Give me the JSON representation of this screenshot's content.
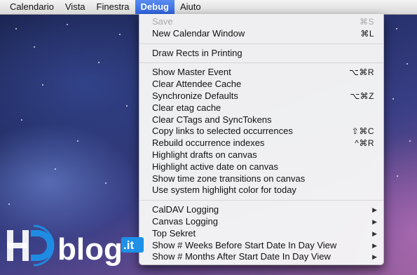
{
  "menubar": {
    "items": [
      {
        "label": "Calendario"
      },
      {
        "label": "Vista"
      },
      {
        "label": "Finestra"
      },
      {
        "label": "Debug"
      },
      {
        "label": "Aiuto"
      }
    ]
  },
  "debug_menu": {
    "groups": [
      [
        {
          "label": "Save",
          "shortcut": "⌘S",
          "enabled": false
        },
        {
          "label": "New Calendar Window",
          "shortcut": "⌘L",
          "enabled": true
        }
      ],
      [
        {
          "label": "Draw Rects in Printing",
          "shortcut": "",
          "enabled": true
        }
      ],
      [
        {
          "label": "Show Master Event",
          "shortcut": "⌥⌘R",
          "enabled": true
        },
        {
          "label": "Clear Attendee Cache",
          "shortcut": "",
          "enabled": true
        },
        {
          "label": "Synchronize Defaults",
          "shortcut": "⌥⌘Z",
          "enabled": true
        },
        {
          "label": "Clear etag cache",
          "shortcut": "",
          "enabled": true
        },
        {
          "label": "Clear CTags and SyncTokens",
          "shortcut": "",
          "enabled": true
        },
        {
          "label": "Copy links to selected occurrences",
          "shortcut": "⇧⌘C",
          "enabled": true
        },
        {
          "label": "Rebuild occurrence indexes",
          "shortcut": "^⌘R",
          "enabled": true
        },
        {
          "label": "Highlight drafts on canvas",
          "shortcut": "",
          "enabled": true
        },
        {
          "label": "Highlight active date on canvas",
          "shortcut": "",
          "enabled": true
        },
        {
          "label": "Show time zone transitions on canvas",
          "shortcut": "",
          "enabled": true
        },
        {
          "label": "Use system highlight color for today",
          "shortcut": "",
          "enabled": true
        }
      ],
      [
        {
          "label": "CalDAV Logging",
          "shortcut": "",
          "submenu": true,
          "enabled": true
        },
        {
          "label": "Canvas Logging",
          "shortcut": "",
          "submenu": true,
          "enabled": true
        },
        {
          "label": "Top Sekret",
          "shortcut": "",
          "submenu": true,
          "enabled": true
        },
        {
          "label": "Show # Weeks Before Start Date In Day View",
          "shortcut": "",
          "submenu": true,
          "enabled": true
        },
        {
          "label": "Show # Months After Start Date In Day View",
          "shortcut": "",
          "submenu": true,
          "enabled": true
        }
      ]
    ]
  },
  "watermark": {
    "hd": "HD",
    "blog": "blog",
    "tld": ".it"
  },
  "colors": {
    "menu_highlight": "#2f63dd",
    "logo_blue": "#1e90e8",
    "disabled_text": "#a8a8a8"
  },
  "icons": {
    "submenu": "triangle-right-icon"
  }
}
